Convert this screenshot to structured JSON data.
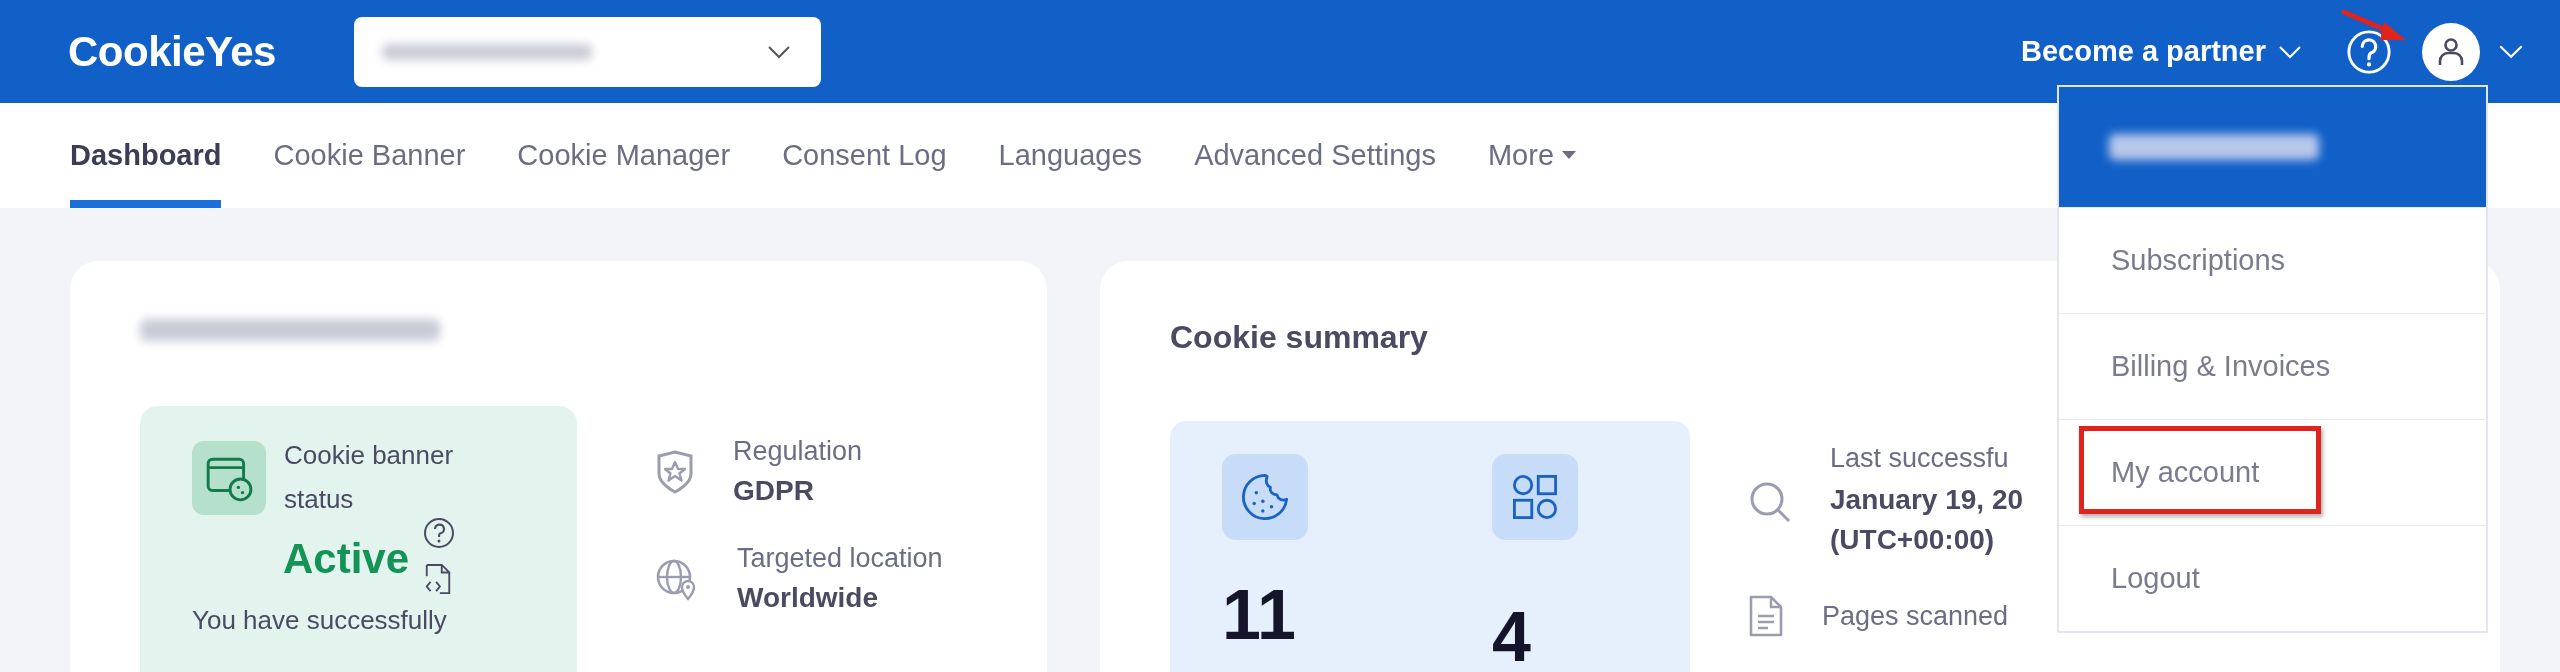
{
  "header": {
    "logo": "CookieYes",
    "partner_link": "Become a partner"
  },
  "nav": {
    "tabs": [
      {
        "label": "Dashboard",
        "selected": true
      },
      {
        "label": "Cookie Banner",
        "selected": false
      },
      {
        "label": "Cookie Manager",
        "selected": false
      },
      {
        "label": "Consent Log",
        "selected": false
      },
      {
        "label": "Languages",
        "selected": false
      },
      {
        "label": "Advanced Settings",
        "selected": false
      },
      {
        "label": "More",
        "selected": false
      }
    ]
  },
  "site_card": {
    "banner_status": {
      "label": "Cookie banner status",
      "status": "Active",
      "description": "You have successfully"
    },
    "details": [
      {
        "kind": "regulation",
        "label": "Regulation",
        "value": "GDPR"
      },
      {
        "kind": "location",
        "label": "Targeted location",
        "value": "Worldwide"
      }
    ]
  },
  "cookie_summary": {
    "title": "Cookie summary",
    "stats": [
      {
        "kind": "cookies",
        "value": "11"
      },
      {
        "kind": "categories",
        "value": "4"
      }
    ],
    "scan": [
      {
        "kind": "scan",
        "label": "Last successfu",
        "value": "January 19, 20",
        "extra": "(UTC+00:00)"
      },
      {
        "kind": "pages",
        "label": "Pages scanned"
      }
    ]
  },
  "account_menu": {
    "items": [
      {
        "label": "Subscriptions",
        "highlighted": false
      },
      {
        "label": "Billing & Invoices",
        "highlighted": false
      },
      {
        "label": "My account",
        "highlighted": true
      },
      {
        "label": "Logout",
        "highlighted": false
      }
    ]
  }
}
